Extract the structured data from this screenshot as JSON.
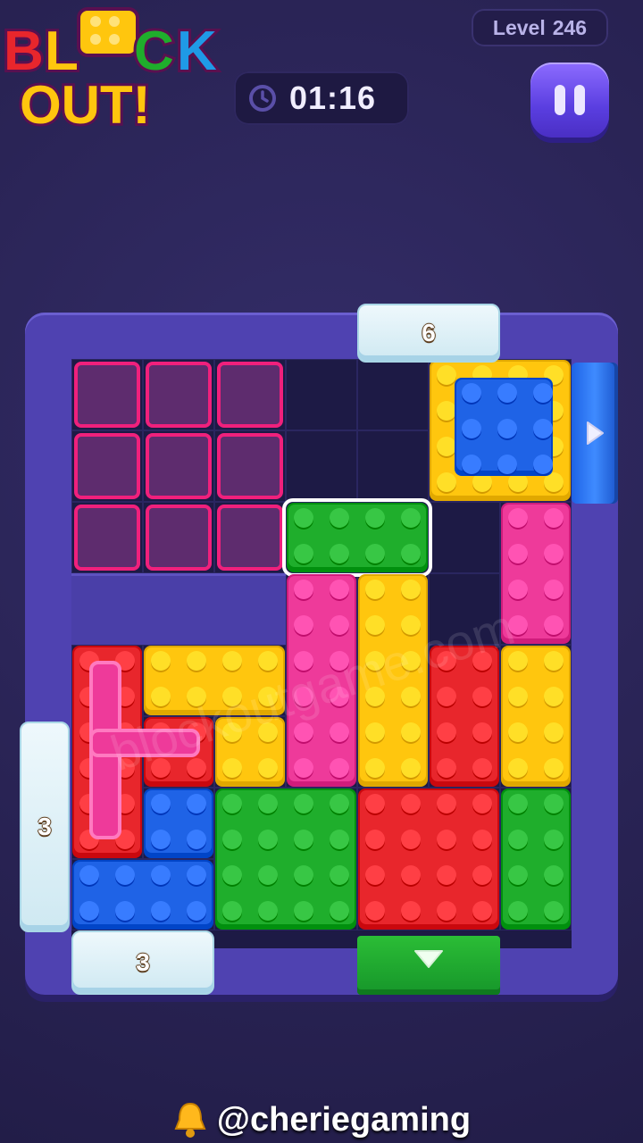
{
  "header": {
    "logo_line1": "BLOCK",
    "logo_line2": "OUT!",
    "level_label": "Level",
    "level_number": "246",
    "timer": "01:16"
  },
  "board": {
    "top_gate_count": "6",
    "left_gate_count": "3",
    "bottom_gate_count": "3"
  },
  "footer": {
    "handle": "@cheriegaming"
  },
  "watermark": "blockoutgame.com",
  "colors": {
    "red": "#e8262c",
    "yellow": "#ffc60e",
    "pink": "#ee3a9a",
    "green": "#1fae2c",
    "blue": "#1f63e6",
    "frame": "#4f42b1"
  },
  "icons": {
    "clock": "clock-icon",
    "pause": "pause-icon",
    "bell": "bell-icon",
    "arrow_right": "arrow-right-icon",
    "arrow_down": "arrow-down-icon"
  }
}
